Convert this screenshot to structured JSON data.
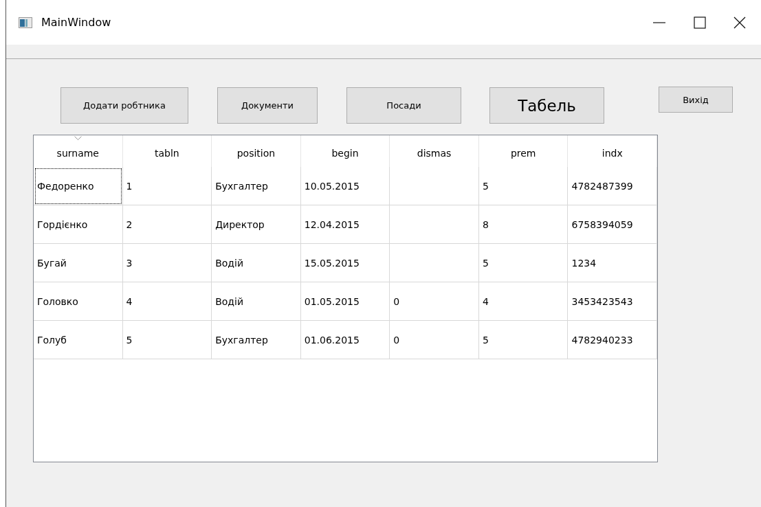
{
  "window": {
    "title": "MainWindow"
  },
  "buttons": [
    {
      "label": "Додати робтника",
      "emphasis": false
    },
    {
      "label": "Документи",
      "emphasis": false
    },
    {
      "label": "Посади",
      "emphasis": false
    },
    {
      "label": "Табель",
      "emphasis": true
    }
  ],
  "exit_button": {
    "label": "Вихід"
  },
  "table": {
    "columns": [
      {
        "label": "surname",
        "sorted": true
      },
      {
        "label": "tabln",
        "sorted": false
      },
      {
        "label": "position",
        "sorted": false
      },
      {
        "label": "begin",
        "sorted": false
      },
      {
        "label": "dismas",
        "sorted": false
      },
      {
        "label": "prem",
        "sorted": false
      },
      {
        "label": "indx",
        "sorted": false
      }
    ],
    "rows": [
      {
        "current": true,
        "cells": [
          "Федоренко",
          "1",
          "Бухгалтер",
          "10.05.2015",
          "",
          "5",
          "4782487399"
        ]
      },
      {
        "current": false,
        "cells": [
          "Гордієнко",
          "2",
          "Директор",
          "12.04.2015",
          "",
          "8",
          "6758394059"
        ]
      },
      {
        "current": false,
        "cells": [
          "Бугай",
          "3",
          "Водій",
          "15.05.2015",
          "",
          "5",
          "1234"
        ]
      },
      {
        "current": false,
        "cells": [
          "Головко",
          "4",
          "Водій",
          "01.05.2015",
          "0",
          "4",
          "3453423543"
        ]
      },
      {
        "current": false,
        "cells": [
          "Голуб",
          "5",
          "Бухгалтер",
          "01.06.2015",
          "0",
          "5",
          "4782940233"
        ]
      }
    ]
  }
}
